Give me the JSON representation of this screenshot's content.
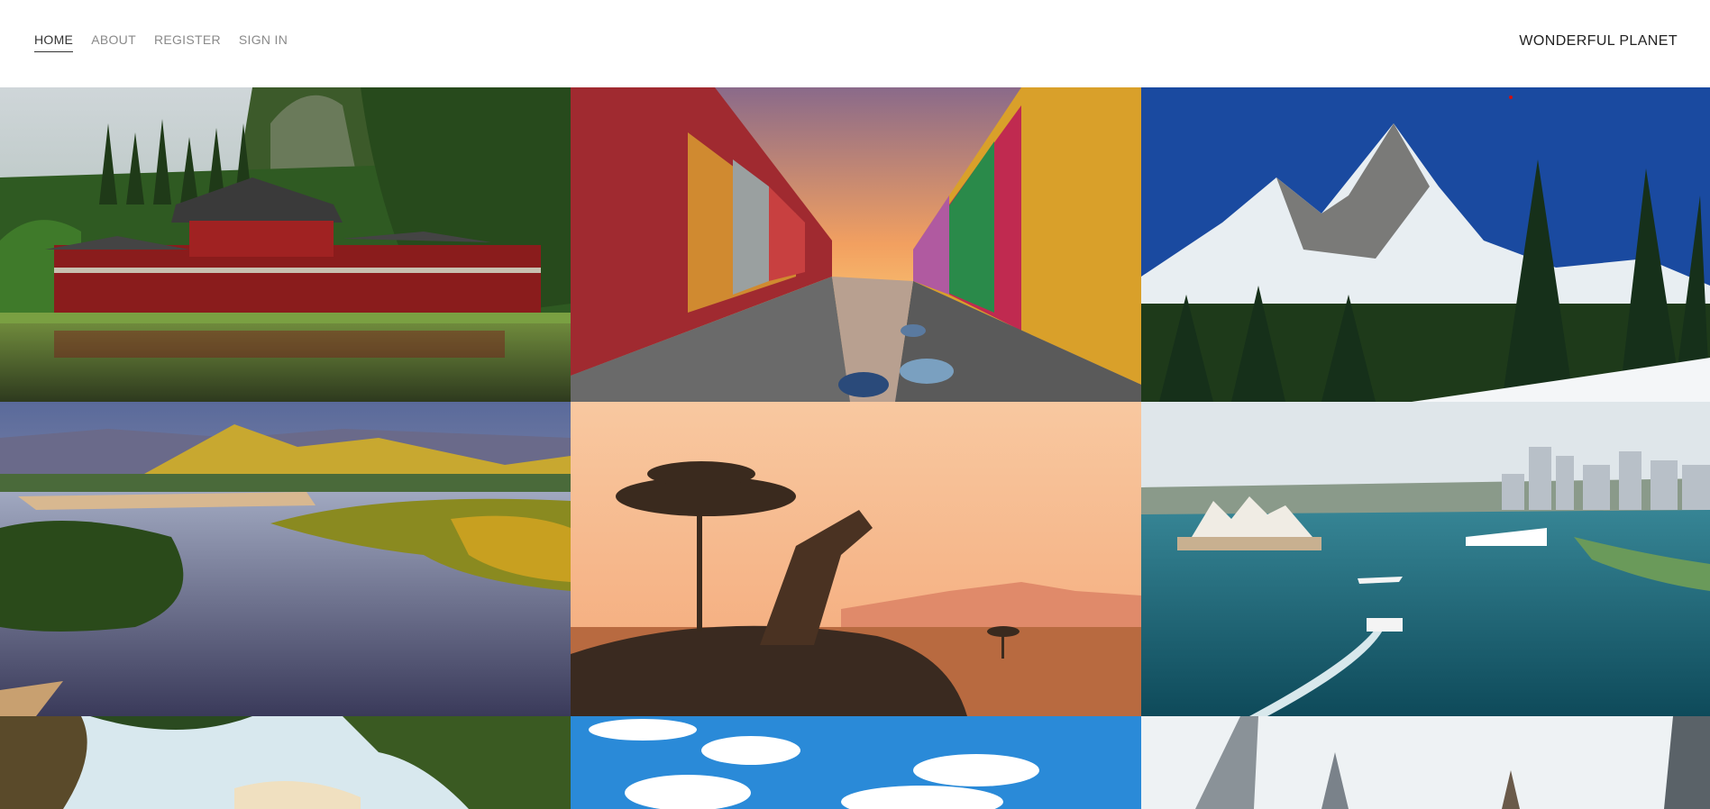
{
  "nav": {
    "items": [
      {
        "label": "HOME",
        "active": true
      },
      {
        "label": "ABOUT",
        "active": false
      },
      {
        "label": "REGISTER",
        "active": false
      },
      {
        "label": "SIGN IN",
        "active": false
      }
    ]
  },
  "brand": {
    "title": "WONDERFUL PLANET"
  },
  "gallery": {
    "photos": [
      {
        "subject": "japanese-temple-by-pond"
      },
      {
        "subject": "colorful-canal-at-sunset"
      },
      {
        "subject": "snowy-mountain-peak-and-forest"
      },
      {
        "subject": "golden-hills-and-river"
      },
      {
        "subject": "giraffe-silhouette-savanna-sunset"
      },
      {
        "subject": "sydney-harbour-opera-house"
      },
      {
        "subject": "palm-trees-beach"
      },
      {
        "subject": "blue-sky-with-clouds"
      },
      {
        "subject": "dubai-towers"
      }
    ]
  },
  "colors": {
    "nav_active": "#333333",
    "nav_inactive": "#8a8a8a",
    "brand_text": "#222222",
    "background": "#ffffff"
  }
}
